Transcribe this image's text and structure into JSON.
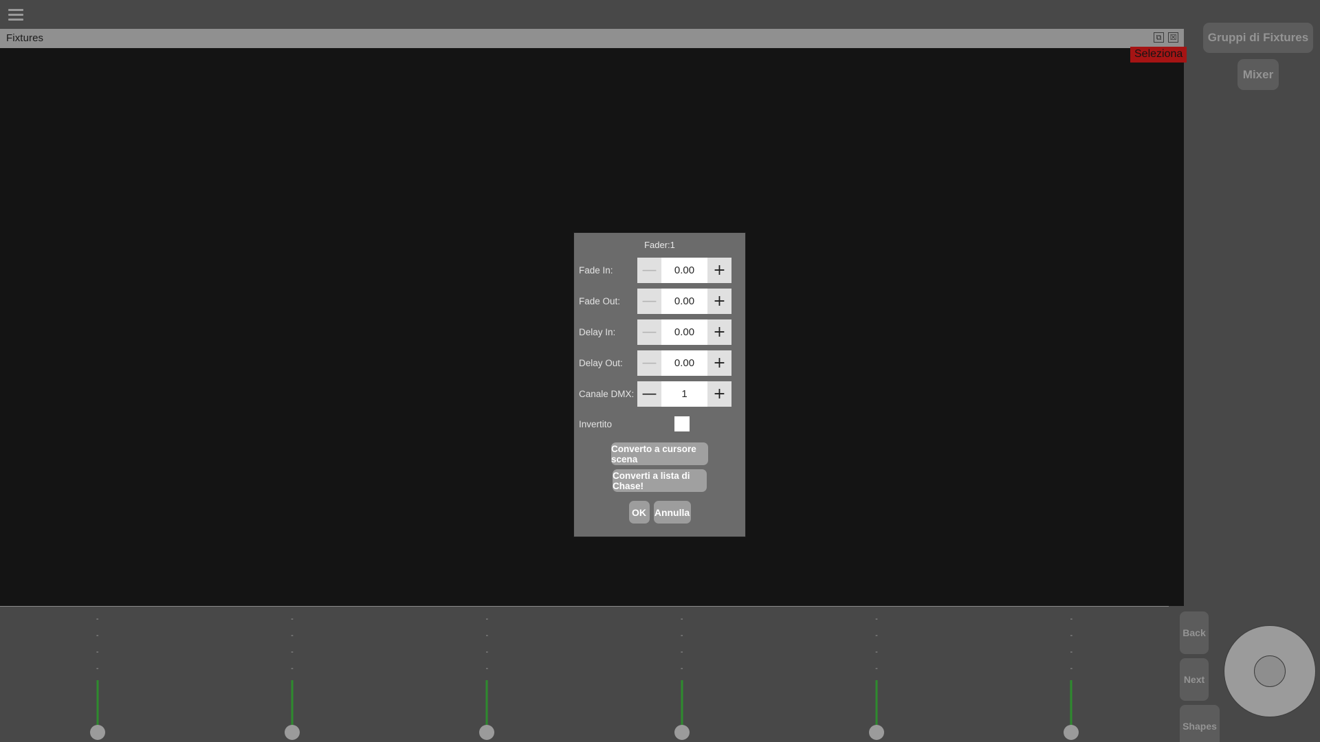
{
  "topbar": {
    "menu_icon": "hamburger-icon"
  },
  "fixtures_window": {
    "title": "Fixtures",
    "restore_icon": "restore-window-icon",
    "close_icon": "close-window-icon",
    "seleziona_label": "Seleziona"
  },
  "right_panel": {
    "buttons": [
      {
        "label": "Gruppi di Fixtures"
      },
      {
        "label": "Mixer"
      }
    ]
  },
  "faders": {
    "marks": [
      "-",
      "-",
      "-",
      "-"
    ],
    "columns": [
      {
        "index": 1
      },
      {
        "index": 2
      },
      {
        "index": 3
      },
      {
        "index": 4
      },
      {
        "index": 5
      },
      {
        "index": 6
      }
    ]
  },
  "transport": {
    "back_label": "Back",
    "next_label": "Next",
    "shapes_label": "Shapes",
    "jog_icon": "jog-wheel"
  },
  "dialog": {
    "title": "Fader:1",
    "rows": [
      {
        "label": "Fade In:",
        "value": "0.00",
        "minus": "—",
        "plus": "+",
        "minus_disabled": true
      },
      {
        "label": "Fade Out:",
        "value": "0.00",
        "minus": "—",
        "plus": "+",
        "minus_disabled": true
      },
      {
        "label": "Delay In:",
        "value": "0.00",
        "minus": "—",
        "plus": "+",
        "minus_disabled": true
      },
      {
        "label": "Delay Out:",
        "value": "0.00",
        "minus": "—",
        "plus": "+",
        "minus_disabled": true
      },
      {
        "label": "Canale DMX:",
        "value": "1",
        "minus": "—",
        "plus": "+",
        "minus_disabled": false
      }
    ],
    "invertito_label": "Invertito",
    "invertito_checked": false,
    "convert_scene_label": "Converto a cursore scena",
    "convert_chase_label": "Converti a lista di Chase!",
    "ok_label": "OK",
    "cancel_label": "Annulla"
  },
  "colors": {
    "app_bg": "#484848",
    "canvas_bg": "#141414",
    "titlebar": "#909090",
    "accent_red": "#a51414",
    "fader_green": "#2e8b2e",
    "dialog_bg": "#6b6b6b"
  }
}
